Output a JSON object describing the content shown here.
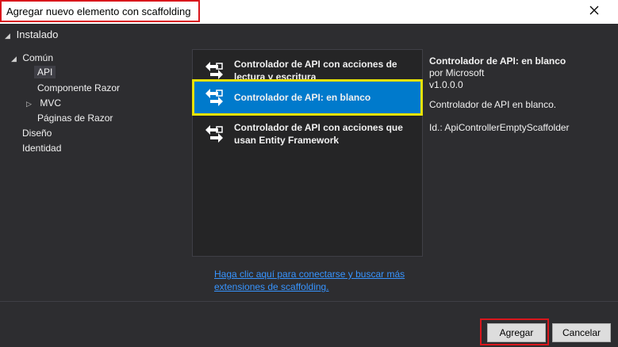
{
  "window": {
    "title": "Agregar nuevo elemento con scaffolding"
  },
  "tree": {
    "installed": "Instalado",
    "items": [
      {
        "label": "Común"
      },
      {
        "label": "API"
      },
      {
        "label": "Componente Razor"
      },
      {
        "label": "MVC"
      },
      {
        "label": "Páginas de Razor"
      },
      {
        "label": "Diseño"
      },
      {
        "label": "Identidad"
      }
    ]
  },
  "templates": [
    {
      "label": "Controlador de API con acciones de lectura y escritura"
    },
    {
      "label": "Controlador de API: en blanco"
    },
    {
      "label": "Controlador de API con acciones que usan Entity Framework"
    }
  ],
  "details": {
    "title": "Controlador de API: en blanco",
    "author": "por Microsoft",
    "version": "v1.0.0.0",
    "description": "Controlador de API en blanco.",
    "id": "Id.: ApiControllerEmptyScaffolder"
  },
  "link": "Haga clic aquí para conectarse y buscar más extensiones de scaffolding.",
  "buttons": {
    "add": "Agregar",
    "cancel": "Cancelar"
  },
  "colors": {
    "accent": "#007acc",
    "highlight_red": "#d9161c",
    "highlight_yellow": "#e8e200"
  }
}
